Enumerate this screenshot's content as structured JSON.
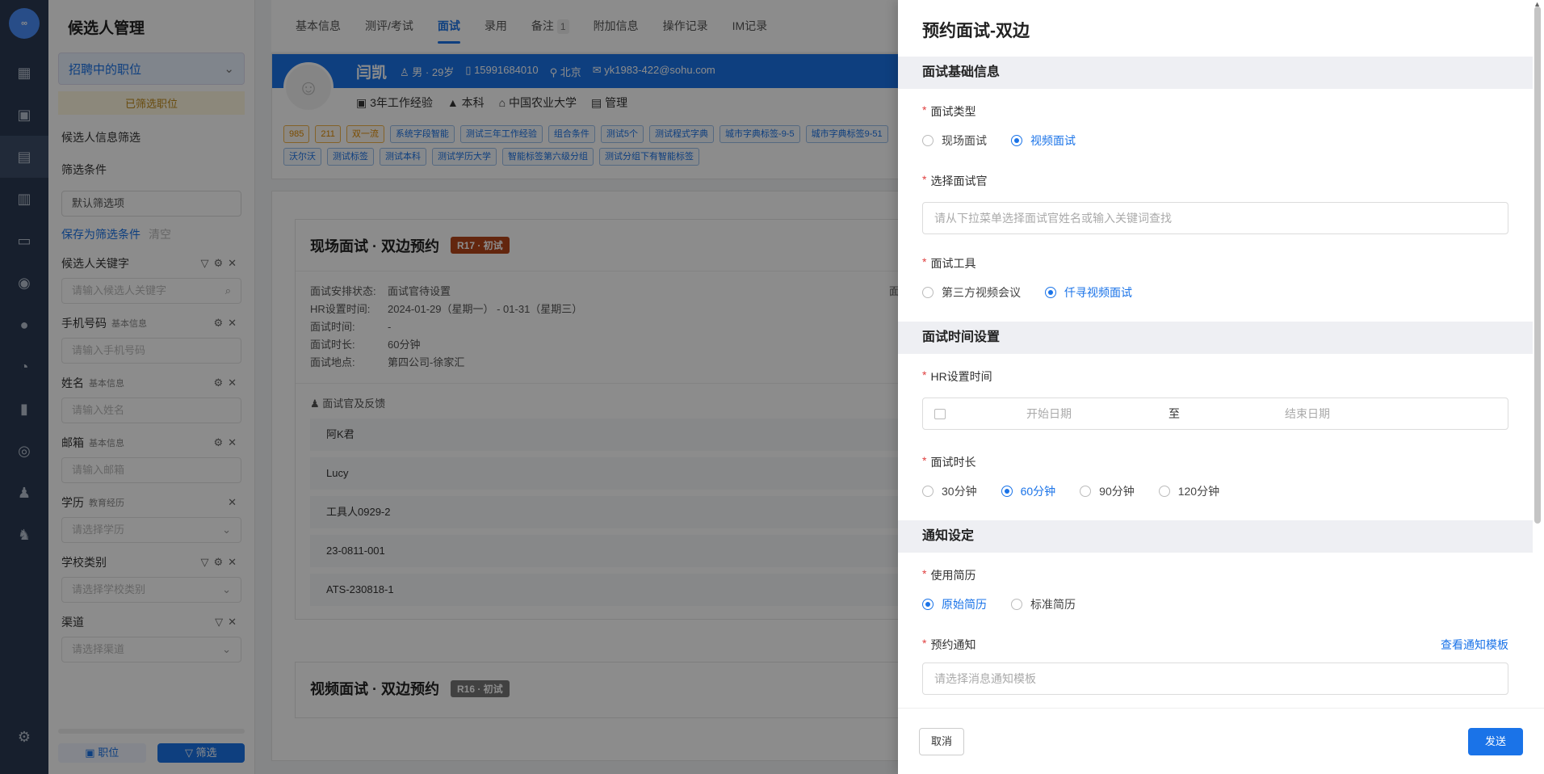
{
  "rail": {
    "logo": "∞"
  },
  "sidebar": {
    "title": "候选人管理",
    "job_select": "招聘中的职位",
    "notice": "已筛选职位",
    "info_filter": "候选人信息筛选",
    "filter_label": "筛选条件",
    "filter_default": "默认筛选项",
    "save_link": "保存为筛选条件",
    "clear_link": "清空",
    "filters": [
      {
        "label": "候选人关键字",
        "tag": "",
        "placeholder": "请输入候选人关键字"
      },
      {
        "label": "手机号码",
        "tag": "基本信息",
        "placeholder": "请输入手机号码"
      },
      {
        "label": "姓名",
        "tag": "基本信息",
        "placeholder": "请输入姓名"
      },
      {
        "label": "邮箱",
        "tag": "基本信息",
        "placeholder": "请输入邮箱"
      },
      {
        "label": "学历",
        "tag": "教育经历",
        "placeholder": "请选择学历"
      },
      {
        "label": "学校类别",
        "tag": "",
        "placeholder": "请选择学校类别"
      },
      {
        "label": "渠道",
        "tag": "",
        "placeholder": "请选择渠道"
      }
    ],
    "bottom_job": "职位",
    "bottom_filter": "筛选"
  },
  "tabs": [
    "基本信息",
    "测评/考试",
    "面试",
    "录用",
    "备注",
    "附加信息",
    "操作记录",
    "IM记录"
  ],
  "tabs_active": "面试",
  "note_count": "1",
  "candidate": {
    "name": "闫凯",
    "gender_age": "男 · 29岁",
    "phone": "15991684010",
    "city": "北京",
    "email": "yk1983-422@sohu.com",
    "experience": "3年工作经验",
    "degree": "本科",
    "school": "中国农业大学",
    "major": "管理",
    "tags_row1": [
      "985",
      "211",
      "双一流",
      "系统字段智能",
      "测试三年工作经验",
      "组合条件",
      "测试5个",
      "测试程式字典",
      "城市字典标签-9-5",
      "城市字典标签9-51"
    ],
    "tags_row2": [
      "沃尔沃",
      "测试标签",
      "测试本科",
      "测试学历大学",
      "智能标签第六级分组",
      "测试分组下有智能标签"
    ]
  },
  "interview1": {
    "title": "现场面试 · 双边预约",
    "badge": "R17 · 初试",
    "status_k": "面试安排状态:",
    "status_v": "面试官待设置",
    "hrtime_k": "HR设置时间:",
    "hrtime_v": "2024-01-29（星期一） -  01-31（星期三）",
    "time_k": "面试时间:",
    "time_v": "-",
    "dur_k": "面试时长:",
    "dur_v": "60分钟",
    "loc_k": "面试地点:",
    "loc_v": "第四公司-徐家汇",
    "feedback_title": "面试官及反馈",
    "interviewers": [
      "阿K君",
      "Lucy",
      "工具人0929-2",
      "23-0811-001",
      "ATS-230818-1"
    ],
    "side_cut": "面"
  },
  "interview2": {
    "title": "视频面试 · 双边预约",
    "badge": "R16 · 初试"
  },
  "drawer": {
    "title": "预约面试-双边",
    "sec_basic": "面试基础信息",
    "type_label": "面试类型",
    "type_options": [
      "现场面试",
      "视频面试"
    ],
    "type_selected": 1,
    "interviewer_label": "选择面试官",
    "interviewer_placeholder": "请从下拉菜单选择面试官姓名或输入关键词查找",
    "tool_label": "面试工具",
    "tool_options": [
      "第三方视频会议",
      "仟寻视频面试"
    ],
    "tool_selected": 1,
    "sec_time": "面试时间设置",
    "hr_time_label": "HR设置时间",
    "start_placeholder": "开始日期",
    "range_sep": "至",
    "end_placeholder": "结束日期",
    "duration_label": "面试时长",
    "duration_options": [
      "30分钟",
      "60分钟",
      "90分钟",
      "120分钟"
    ],
    "duration_selected": 1,
    "sec_notify": "通知设定",
    "resume_label": "使用简历",
    "resume_options": [
      "原始简历",
      "标准简历"
    ],
    "resume_selected": 0,
    "notice_label": "预约通知",
    "notice_link": "查看通知模板",
    "notice_placeholder": "请选择消息通知模板",
    "cancel": "取消",
    "send": "发送"
  }
}
